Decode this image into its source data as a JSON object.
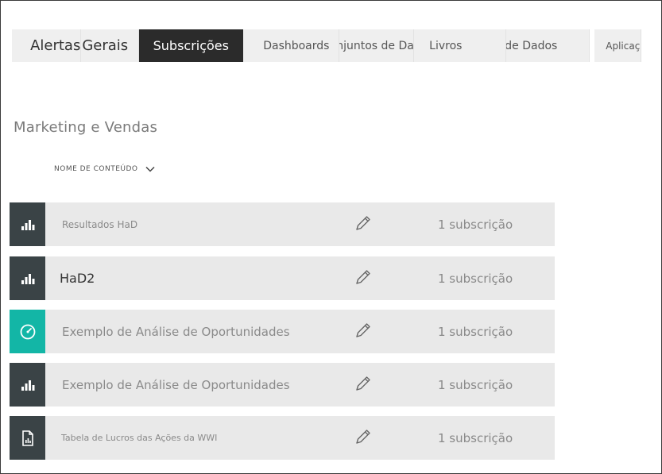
{
  "tabs": [
    {
      "label": "Alertas",
      "active": false
    },
    {
      "label": "Gerais",
      "active": false
    },
    {
      "label": "Subscrições",
      "active": true
    },
    {
      "label": "Dashboards",
      "active": false
    },
    {
      "label": "Conjuntos de Dados",
      "active": false
    },
    {
      "label": "Livros",
      "active": false
    },
    {
      "label": "Fluxos de Dados",
      "active": false
    },
    {
      "label": "Aplicação",
      "active": false
    }
  ],
  "section": {
    "title": "Marketing e Vendas",
    "sort_label": "NOME DE CONTEÚDO"
  },
  "rows": [
    {
      "name": "Resultados HaD",
      "subscriptions": "1 subscrição",
      "icon": "bar-chart-icon"
    },
    {
      "name": "HaD2",
      "subscriptions": "1 subscrição",
      "icon": "bar-chart-icon"
    },
    {
      "name": "Exemplo de Análise de Oportunidades",
      "subscriptions": "1 subscrição",
      "icon": "gauge-icon"
    },
    {
      "name": "Exemplo de Análise de Oportunidades",
      "subscriptions": "1 subscrição",
      "icon": "bar-chart-icon"
    },
    {
      "name": "Tabela de Lucros das Ações da WWI",
      "subscriptions": "1 subscrição",
      "icon": "report-icon"
    }
  ],
  "colors": {
    "active_tab": "#2b2b2b",
    "tile_dark": "#3a4346",
    "tile_accent": "#13b6a6",
    "row_bg": "#e9e9e9"
  }
}
